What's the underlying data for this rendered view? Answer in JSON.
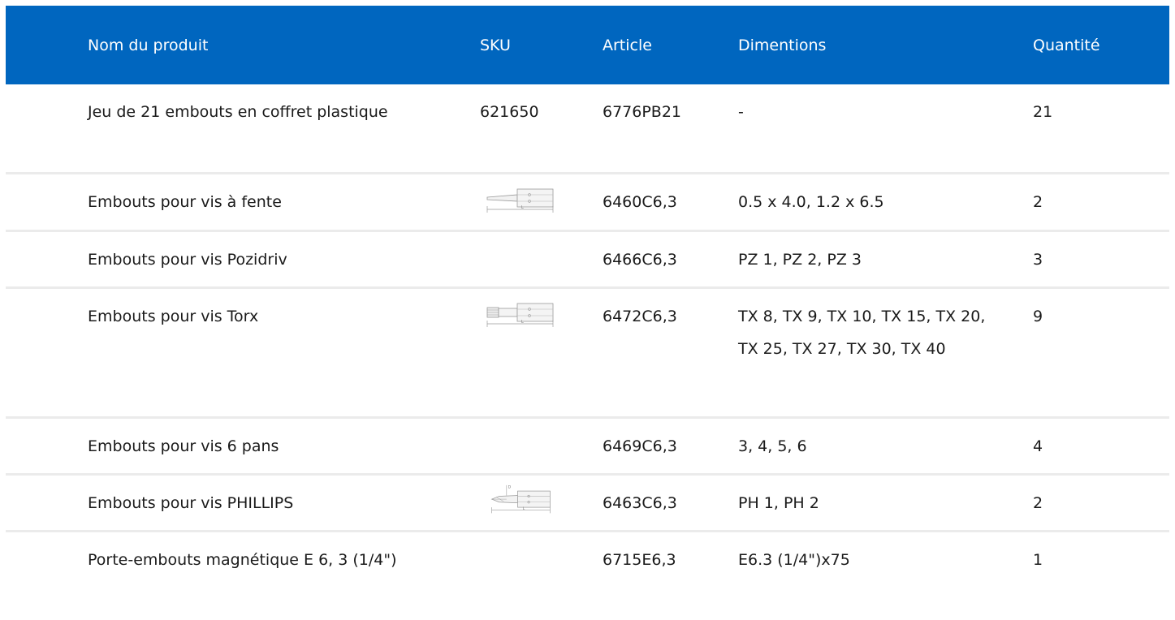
{
  "columns": {
    "name": "Nom du produit",
    "sku": "SKU",
    "article": "Article",
    "dimensions": "Dimentions",
    "quantity": "Quantité"
  },
  "rows": [
    {
      "name": "Jeu de 21 embouts en coffret plastique",
      "sku": "621650",
      "article": "6776PB21",
      "dimensions": "-",
      "quantity": "21",
      "thumb": "none"
    },
    {
      "name": "Embouts pour vis à fente",
      "sku": "",
      "article": "6460C6,3",
      "dimensions": "0.5 x 4.0, 1.2 x 6.5",
      "quantity": "2",
      "thumb": "slotted-bit-icon"
    },
    {
      "name": "Embouts pour vis Pozidriv",
      "sku": "",
      "article": "6466C6,3",
      "dimensions": "PZ 1, PZ 2, PZ 3",
      "quantity": "3",
      "thumb": "none"
    },
    {
      "name": "Embouts pour vis Torx",
      "sku": "",
      "article": "6472C6,3",
      "dimensions": "TX 8, TX 9, TX 10, TX 15, TX 20, TX 25, TX 27, TX 30, TX 40",
      "quantity": "9",
      "thumb": "torx-bit-icon"
    },
    {
      "name": "Embouts pour vis 6 pans",
      "sku": "",
      "article": "6469C6,3",
      "dimensions": "3, 4, 5, 6",
      "quantity": "4",
      "thumb": "none"
    },
    {
      "name": "Embouts pour vis PHILLIPS",
      "sku": "",
      "article": "6463C6,3",
      "dimensions": "PH 1, PH 2",
      "quantity": "2",
      "thumb": "phillips-bit-icon"
    },
    {
      "name": "Porte-embouts magnétique E 6, 3 (1/4\")",
      "sku": "",
      "article": "6715E6,3",
      "dimensions": "E6.3 (1/4\")x75",
      "quantity": "1",
      "thumb": "none"
    }
  ],
  "drawing_labels": {
    "length": "L",
    "diameter": "D"
  },
  "colors": {
    "header_bg": "#0066bf",
    "header_text": "#ffffff",
    "row_divider": "#ebebeb"
  }
}
